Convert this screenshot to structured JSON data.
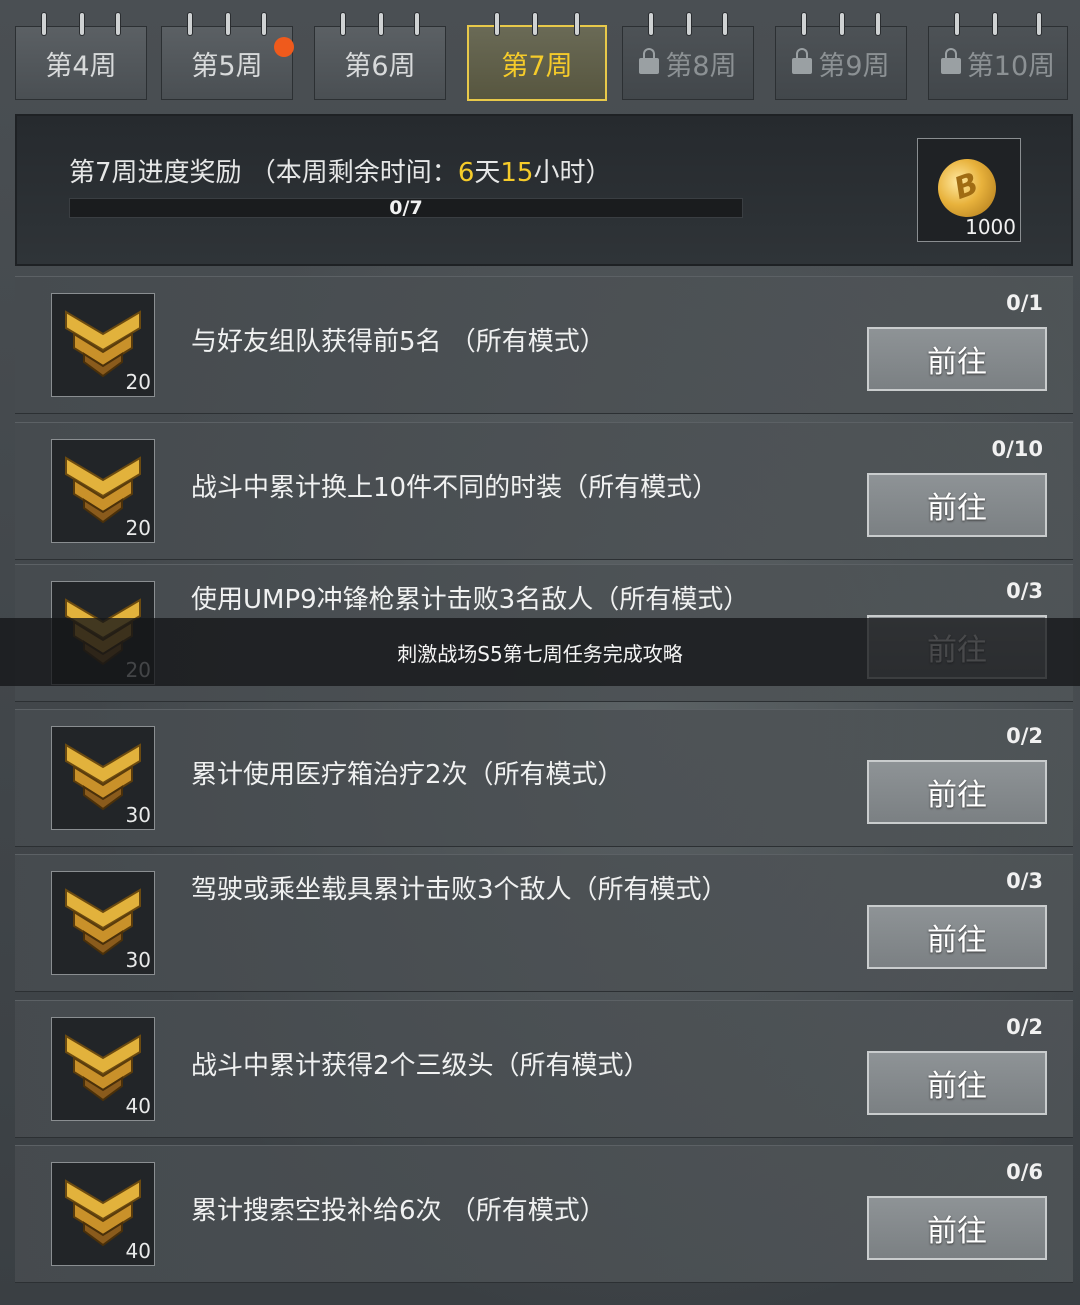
{
  "tabs": [
    {
      "label": "第4周",
      "state": "normal"
    },
    {
      "label": "第5周",
      "state": "normal",
      "notification": true
    },
    {
      "label": "第6周",
      "state": "normal"
    },
    {
      "label": "第7周",
      "state": "active"
    },
    {
      "label": "第8周",
      "state": "locked",
      "icon": "lock-icon"
    },
    {
      "label": "第9周",
      "state": "locked",
      "icon": "lock-icon"
    },
    {
      "label": "第10周",
      "state": "locked",
      "icon": "lock-icon"
    }
  ],
  "progress": {
    "title_prefix": "第7周进度奖励 （本周剩余时间：",
    "days": "6",
    "days_unit": "天",
    "hours": "15",
    "hours_unit": "小时）",
    "bar_text": "0/7",
    "fraction": 0,
    "reward": {
      "icon": "bp-coin-icon",
      "coin_letter": "B",
      "quantity": "1000"
    }
  },
  "missions": [
    {
      "points": "20",
      "text": "与好友组队获得前5名 （所有模式）",
      "count": "0/1",
      "button": "前往",
      "icon": "rank-chevron-icon"
    },
    {
      "points": "20",
      "text": "战斗中累计换上10件不同的时装（所有模式）",
      "count": "0/10",
      "button": "前往",
      "icon": "rank-chevron-icon"
    },
    {
      "points": "20",
      "text": "使用UMP9冲锋枪累计击败3名敌人（所有模式）",
      "count": "0/3",
      "button": "前往",
      "icon": "rank-chevron-icon"
    },
    {
      "points": "30",
      "text": "累计使用医疗箱治疗2次（所有模式）",
      "count": "0/2",
      "button": "前往",
      "icon": "rank-chevron-icon"
    },
    {
      "points": "30",
      "text": "驾驶或乘坐载具累计击败3个敌人（所有模式）",
      "count": "0/3",
      "button": "前往",
      "icon": "rank-chevron-icon"
    },
    {
      "points": "40",
      "text": "战斗中累计获得2个三级头（所有模式）",
      "count": "0/2",
      "button": "前往",
      "icon": "rank-chevron-icon"
    },
    {
      "points": "40",
      "text": "累计搜索空投补给6次 （所有模式）",
      "count": "0/6",
      "button": "前往",
      "icon": "rank-chevron-icon"
    }
  ],
  "caption": "刺激战场S5第七周任务完成攻略",
  "colors": {
    "accent": "#f5cb2a",
    "notification": "#ef5a1c"
  }
}
